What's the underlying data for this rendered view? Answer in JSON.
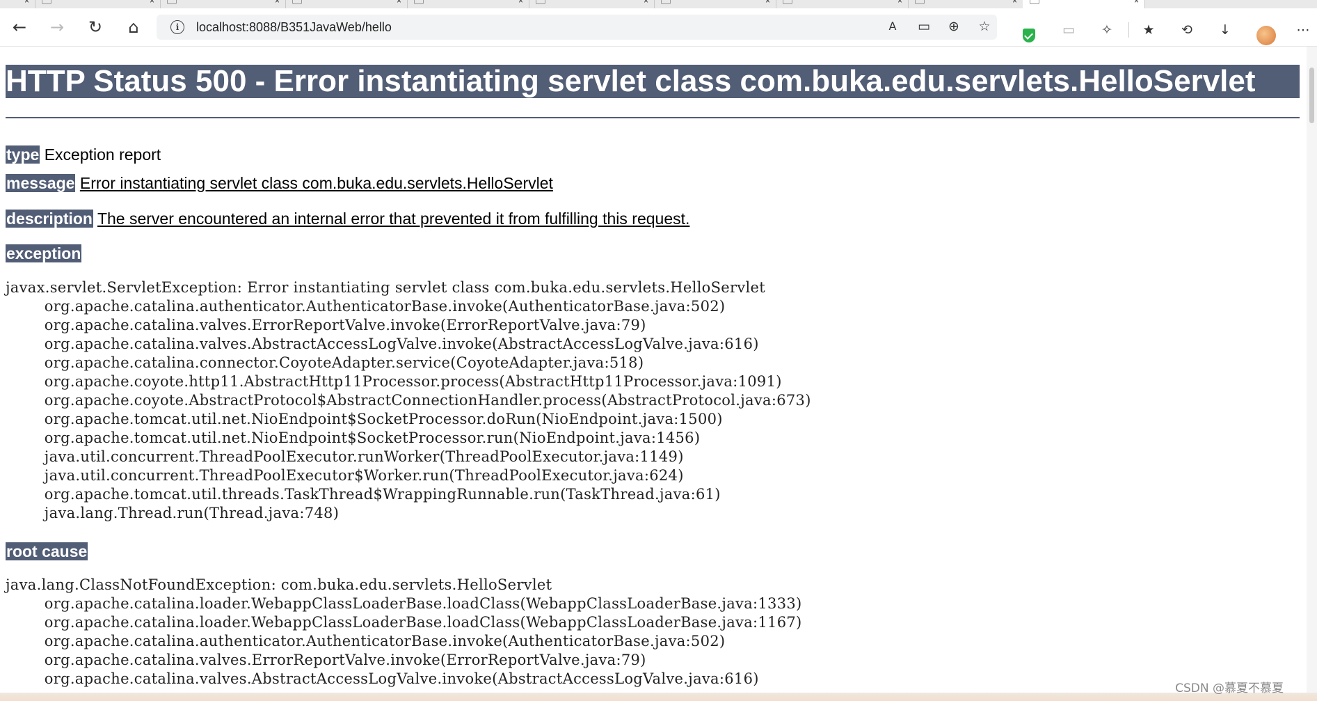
{
  "browser": {
    "tabs": [
      {
        "label": "",
        "active": false
      },
      {
        "label": "",
        "active": false
      },
      {
        "label": "",
        "active": false
      },
      {
        "label": "",
        "active": false
      },
      {
        "label": "",
        "active": false
      },
      {
        "label": "",
        "active": false
      },
      {
        "label": "",
        "active": false
      },
      {
        "label": "",
        "active": false
      },
      {
        "label": "",
        "active": false
      },
      {
        "label": "",
        "active": true
      }
    ],
    "address": "localhost:8088/B351JavaWeb/hello",
    "icons": {
      "back": "←",
      "forward": "→",
      "reload": "↻",
      "home": "⌂",
      "info": "i",
      "read_aloud": "A",
      "immersive": "▭",
      "zoom": "⊕",
      "favorite_add": "☆",
      "extensions": "✧",
      "favorites": "★",
      "history": "⟲",
      "downloads": "↓",
      "menu": "⋯"
    }
  },
  "page": {
    "title": "HTTP Status 500 - Error instantiating servlet class com.buka.edu.servlets.HelloServlet",
    "type_label": "type",
    "type_value": "Exception report",
    "message_label": "message",
    "message_value": "Error instantiating servlet class com.buka.edu.servlets.HelloServlet",
    "description_label": "description",
    "description_value": "The server encountered an internal error that prevented it from fulfilling this request.",
    "exception_label": "exception",
    "exception_trace": [
      "javax.servlet.ServletException: Error instantiating servlet class com.buka.edu.servlets.HelloServlet",
      "\torg.apache.catalina.authenticator.AuthenticatorBase.invoke(AuthenticatorBase.java:502)",
      "\torg.apache.catalina.valves.ErrorReportValve.invoke(ErrorReportValve.java:79)",
      "\torg.apache.catalina.valves.AbstractAccessLogValve.invoke(AbstractAccessLogValve.java:616)",
      "\torg.apache.catalina.connector.CoyoteAdapter.service(CoyoteAdapter.java:518)",
      "\torg.apache.coyote.http11.AbstractHttp11Processor.process(AbstractHttp11Processor.java:1091)",
      "\torg.apache.coyote.AbstractProtocol$AbstractConnectionHandler.process(AbstractProtocol.java:673)",
      "\torg.apache.tomcat.util.net.NioEndpoint$SocketProcessor.doRun(NioEndpoint.java:1500)",
      "\torg.apache.tomcat.util.net.NioEndpoint$SocketProcessor.run(NioEndpoint.java:1456)",
      "\tjava.util.concurrent.ThreadPoolExecutor.runWorker(ThreadPoolExecutor.java:1149)",
      "\tjava.util.concurrent.ThreadPoolExecutor$Worker.run(ThreadPoolExecutor.java:624)",
      "\torg.apache.tomcat.util.threads.TaskThread$WrappingRunnable.run(TaskThread.java:61)",
      "\tjava.lang.Thread.run(Thread.java:748)"
    ],
    "root_cause_label": "root cause",
    "root_cause_trace": [
      "java.lang.ClassNotFoundException: com.buka.edu.servlets.HelloServlet",
      "\torg.apache.catalina.loader.WebappClassLoaderBase.loadClass(WebappClassLoaderBase.java:1333)",
      "\torg.apache.catalina.loader.WebappClassLoaderBase.loadClass(WebappClassLoaderBase.java:1167)",
      "\torg.apache.catalina.authenticator.AuthenticatorBase.invoke(AuthenticatorBase.java:502)",
      "\torg.apache.catalina.valves.ErrorReportValve.invoke(ErrorReportValve.java:79)",
      "\torg.apache.catalina.valves.AbstractAccessLogValve.invoke(AbstractAccessLogValve.java:616)"
    ]
  },
  "watermark": "CSDN @慕夏不慕夏",
  "colors": {
    "tomcat_header": "#525d76",
    "shield_green": "#2bb24c"
  }
}
